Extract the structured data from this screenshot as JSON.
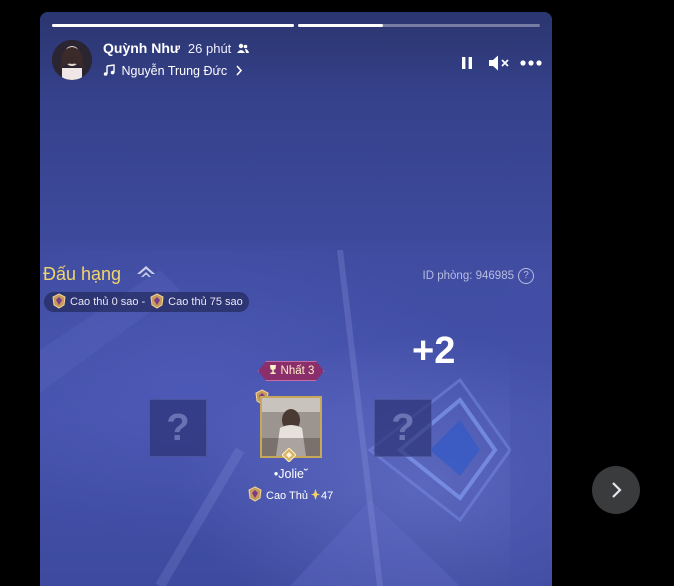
{
  "story": {
    "progress": [
      1.0,
      0.35
    ],
    "author": "Quỳnh Như",
    "time": "26 phút",
    "audience_icon": "friends-icon",
    "music_icon": "music-note-icon",
    "music": "Nguyễn Trung Đức",
    "controls": [
      "pause-icon",
      "mute-icon",
      "more-icon"
    ]
  },
  "game": {
    "title": "Đấu hạng",
    "room_label": "ID phòng: 946985",
    "rank_range": {
      "from": "Cao thủ 0 sao",
      "sep": "-",
      "to": "Cao thủ 75 sao"
    },
    "plus": "+2",
    "slot_mark": "?",
    "player": {
      "badge": "Nhất 3",
      "name": "•Jolie˘",
      "rank": "Cao Thủ",
      "stars": "47"
    }
  },
  "colors": {
    "title": "#f2d56a",
    "accent_gold": "#c7a85a",
    "badge": "#8a2f6c"
  }
}
